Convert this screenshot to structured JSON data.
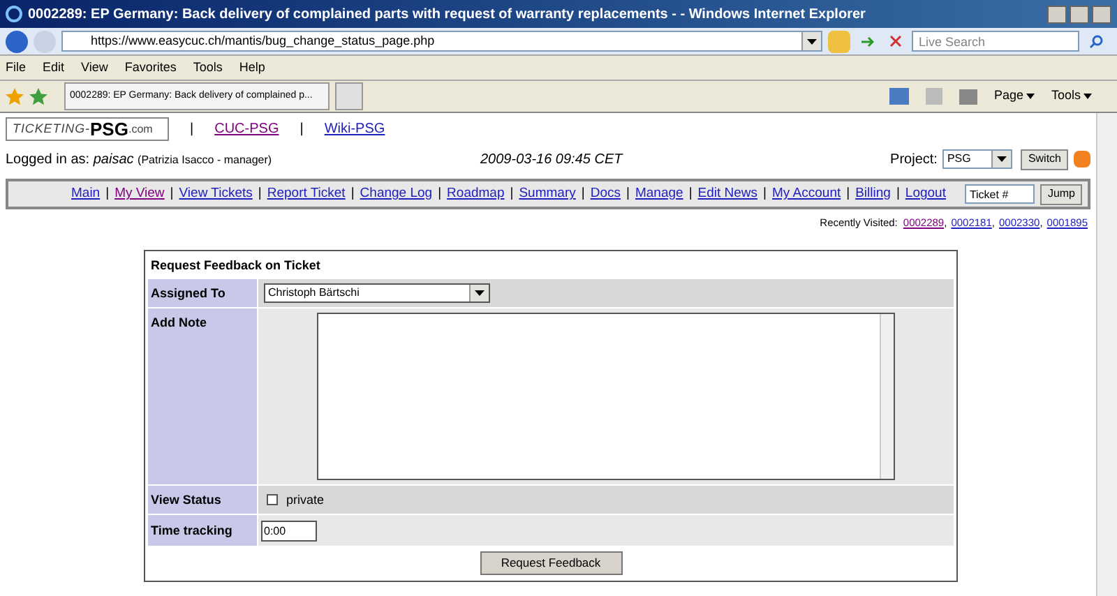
{
  "window": {
    "title": "0002289: EP Germany: Back delivery of complained parts with request of warranty replacements -  - Windows Internet Explorer"
  },
  "address_bar": {
    "url": "https://www.easycuc.ch/mantis/bug_change_status_page.php"
  },
  "search": {
    "placeholder": "Live Search"
  },
  "menu": [
    "File",
    "Edit",
    "View",
    "Favorites",
    "Tools",
    "Help"
  ],
  "tab": {
    "label": "0002289: EP Germany: Back delivery of complained p..."
  },
  "command_bar": [
    {
      "label": "Page"
    },
    {
      "label": "Tools"
    }
  ],
  "header": {
    "logo_left": "TICKETING-",
    "logo_main": "PSG",
    "logo_right": ".com",
    "items": [
      {
        "kind": "separator",
        "label": "|"
      },
      {
        "kind": "link",
        "label": "CUC-PSG",
        "visited": true
      },
      {
        "kind": "separator",
        "label": "|"
      },
      {
        "kind": "link",
        "label": "Wiki-PSG",
        "visited": false
      }
    ]
  },
  "login": {
    "prefix": "Logged in as:",
    "user": "paisac",
    "detail": "(Patrizia Isacco - manager)",
    "datetime": "2009-03-16 09:45 CET",
    "project_label": "Project:",
    "project": "PSG",
    "switch": "Switch"
  },
  "nav": [
    {
      "kind": "link",
      "label": "Main",
      "visited": false
    },
    {
      "kind": "separator",
      "label": "|"
    },
    {
      "kind": "link",
      "label": "My View",
      "visited": true
    },
    {
      "kind": "separator",
      "label": "|"
    },
    {
      "kind": "link",
      "label": "View Tickets",
      "visited": false
    },
    {
      "kind": "separator",
      "label": "|"
    },
    {
      "kind": "link",
      "label": "Report Ticket",
      "visited": false
    },
    {
      "kind": "separator",
      "label": "|"
    },
    {
      "kind": "link",
      "label": "Change Log",
      "visited": false
    },
    {
      "kind": "separator",
      "label": "|"
    },
    {
      "kind": "link",
      "label": "Roadmap",
      "visited": false
    },
    {
      "kind": "separator",
      "label": "|"
    },
    {
      "kind": "link",
      "label": "Summary",
      "visited": false
    },
    {
      "kind": "separator",
      "label": "|"
    },
    {
      "kind": "link",
      "label": "Docs",
      "visited": false
    },
    {
      "kind": "separator",
      "label": "|"
    },
    {
      "kind": "link",
      "label": "Manage",
      "visited": false
    },
    {
      "kind": "separator",
      "label": "|"
    },
    {
      "kind": "link",
      "label": "Edit News",
      "visited": false
    },
    {
      "kind": "separator",
      "label": "|"
    },
    {
      "kind": "link",
      "label": "My Account",
      "visited": false
    },
    {
      "kind": "separator",
      "label": "|"
    },
    {
      "kind": "link",
      "label": "Billing",
      "visited": false
    },
    {
      "kind": "separator",
      "label": "|"
    },
    {
      "kind": "link",
      "label": "Logout",
      "visited": false
    }
  ],
  "jump": {
    "value": "Ticket #",
    "button": "Jump"
  },
  "recently_visited": {
    "label": "Recently Visited:",
    "items": [
      {
        "kind": "link",
        "label": "0002289",
        "visited": true
      },
      {
        "kind": "separator",
        "label": ","
      },
      {
        "kind": "link",
        "label": "0002181",
        "visited": false
      },
      {
        "kind": "separator",
        "label": ","
      },
      {
        "kind": "link",
        "label": "0002330",
        "visited": false
      },
      {
        "kind": "separator",
        "label": ","
      },
      {
        "kind": "link",
        "label": "0001895",
        "visited": false
      }
    ]
  },
  "form": {
    "title": "Request Feedback on Ticket",
    "assigned_label": "Assigned To",
    "assigned": "Christoph Bärtschi",
    "note_label": "Add Note",
    "view_status_label": "View Status",
    "private_label": "private",
    "private_checked": false,
    "time_label": "Time tracking",
    "time": "0:00",
    "submit": "Request Feedback"
  }
}
